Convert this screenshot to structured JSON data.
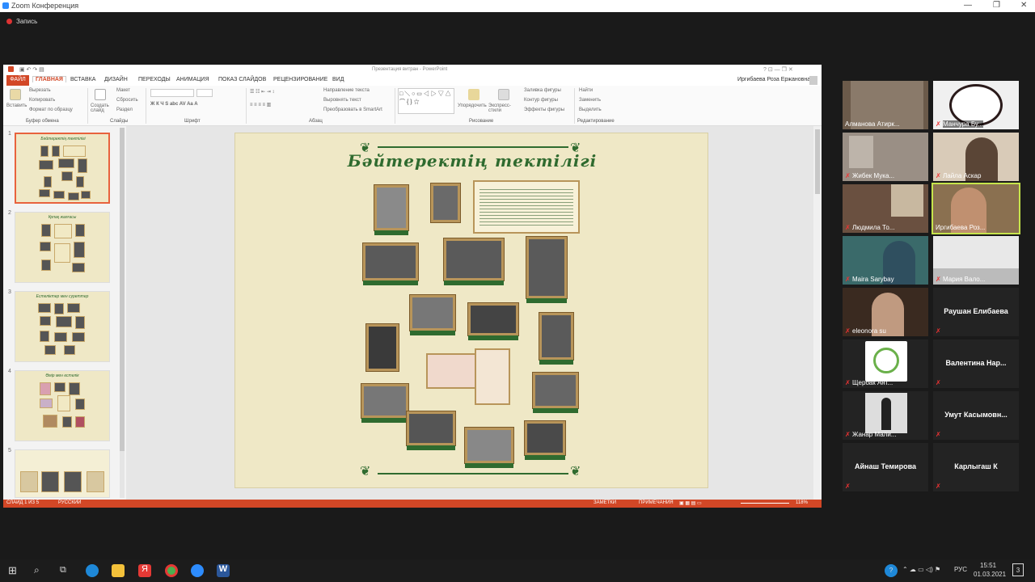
{
  "zoom": {
    "title": "Zoom Конференция",
    "recording": "Запись",
    "window_controls": [
      "—",
      "❐",
      "✕"
    ]
  },
  "ppt": {
    "window_title": "Презентация витран - PowerPoint",
    "tabs": [
      "ФАЙЛ",
      "ГЛАВНАЯ",
      "ВСТАВКА",
      "ДИЗАЙН",
      "ПЕРЕХОДЫ",
      "АНИМАЦИЯ",
      "ПОКАЗ СЛАЙДОВ",
      "РЕЦЕНЗИРОВАНИЕ",
      "ВИД"
    ],
    "user": "Иргибаева Роза Ержановна",
    "ribbon": {
      "paste": "Вставить",
      "cut": "Вырезать",
      "copy": "Копировать",
      "format_painter": "Формат по образцу",
      "clipboard_group": "Буфер обмена",
      "new_slide": "Создать слайд",
      "layout": "Макет",
      "reset": "Сбросить",
      "section": "Раздел",
      "slides_group": "Слайды",
      "font_group": "Шрифт",
      "paragraph_group": "Абзац",
      "text_direction": "Направление текста",
      "align_text": "Выровнять текст",
      "smartart": "Преобразовать в SmartArt",
      "arrange": "Упорядочить",
      "quick_styles": "Экспресс-стили",
      "shape_fill": "Заливка фигуры",
      "shape_outline": "Контур фигуры",
      "shape_effects": "Эффекты фигуры",
      "drawing_group": "Рисование",
      "find": "Найти",
      "replace": "Заменить",
      "select": "Выделить",
      "editing_group": "Редактирование"
    },
    "thumbnails": [
      {
        "num": "1",
        "title": "Бәйтеректің тектілігі"
      },
      {
        "num": "2",
        "title": "Ұрпақ жалғасы"
      },
      {
        "num": "3",
        "title": "Естеліктер мен суреттер"
      },
      {
        "num": "4",
        "title": "Өмір мен естелік"
      },
      {
        "num": "5",
        "title": ""
      }
    ],
    "slide_title": "Бәйтеректің тектілігі",
    "status": {
      "slide": "СЛАЙД 1 ИЗ 5",
      "language": "РУССКИЙ",
      "notes": "ЗАМЕТКИ",
      "comments": "ПРИМЕЧАНИЯ",
      "zoom": "118%"
    }
  },
  "participants": [
    {
      "name": "Алманова Атирк...",
      "video": true,
      "muted": false
    },
    {
      "name": "Манчура Бу...",
      "video": true,
      "muted": true
    },
    {
      "name": "Жибек Мука...",
      "video": true,
      "muted": true
    },
    {
      "name": "Лайла Аскар",
      "video": true,
      "muted": true
    },
    {
      "name": "Людмила То...",
      "video": true,
      "muted": true
    },
    {
      "name": "Иргибаева Роз...",
      "video": true,
      "muted": false,
      "active": true
    },
    {
      "name": "Maira Sarybay",
      "video": true,
      "muted": true
    },
    {
      "name": "Мария Вало...",
      "video": true,
      "muted": true
    },
    {
      "name": "eleonora su",
      "video": true,
      "muted": true
    },
    {
      "name": "Раушан Елибаева",
      "video": false,
      "muted": true
    },
    {
      "name": "Щербак Ант...",
      "video": true,
      "muted": true
    },
    {
      "name": "Валентина Нар...",
      "video": false,
      "muted": true
    },
    {
      "name": "Жанар Мали...",
      "video": true,
      "muted": true
    },
    {
      "name": "Умут Касымовн...",
      "video": false,
      "muted": true
    },
    {
      "name": "Айнаш Темирова",
      "video": false,
      "muted": true
    },
    {
      "name": "Карлыгаш К",
      "video": false,
      "muted": true
    }
  ],
  "taskbar": {
    "language": "РУС",
    "time": "15:51",
    "date": "01.03.2021",
    "notifications": "3"
  },
  "colors": {
    "ppt_accent": "#d24726",
    "slide_bg": "#efe8c6",
    "slide_green": "#2f6b2f",
    "active_speaker": "#c6e44b"
  }
}
